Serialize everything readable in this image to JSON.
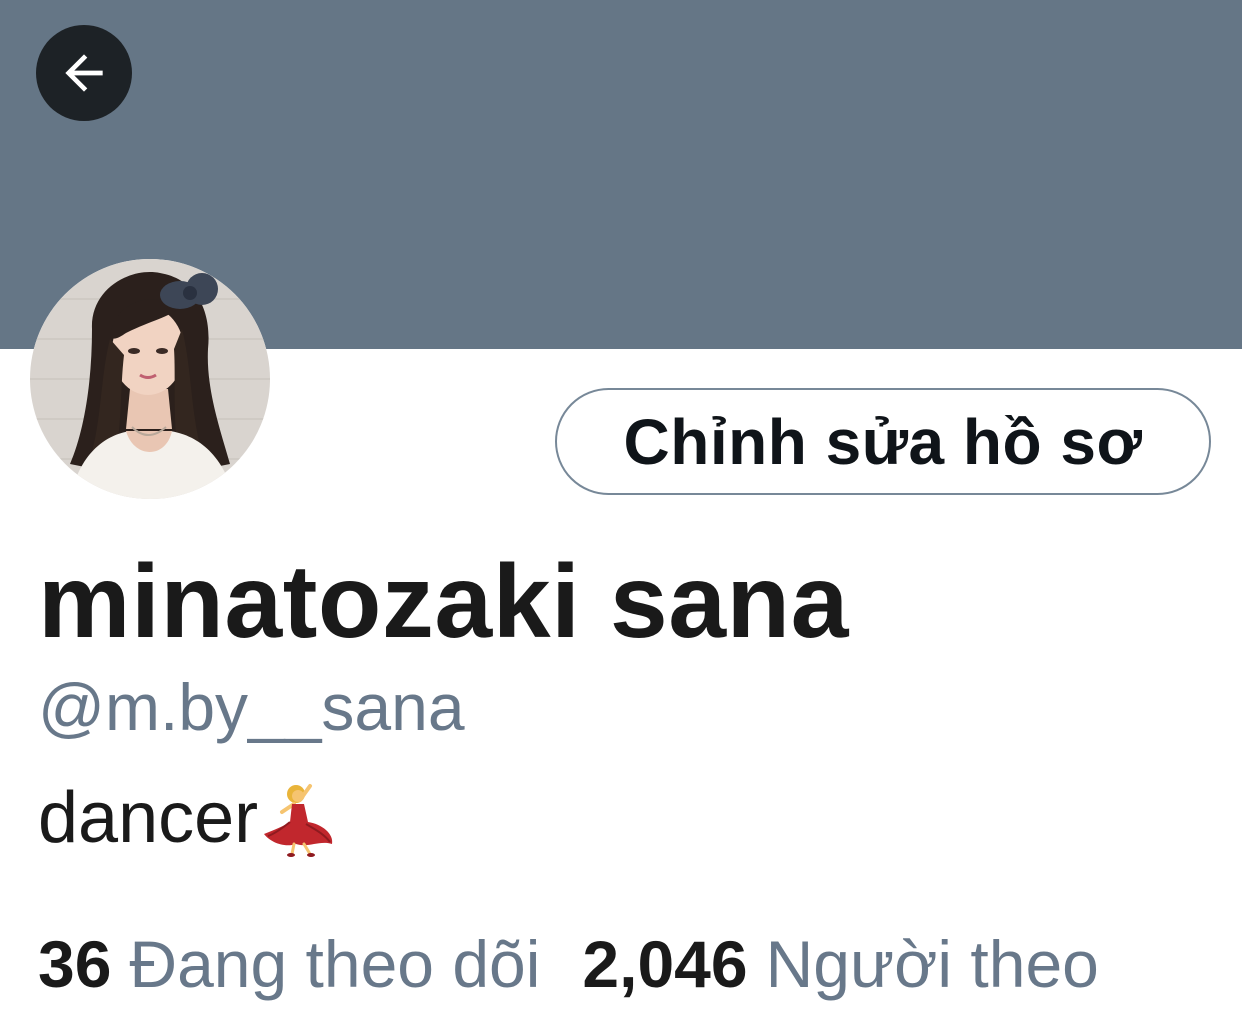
{
  "header": {
    "back_icon": "arrow-left-icon",
    "banner_color": "#657686"
  },
  "profile": {
    "avatar_icon": "profile-photo",
    "edit_button_label": "Chỉnh sửa hồ sơ",
    "display_name": "minatozaki sana",
    "handle": "@m.by__sana",
    "bio_text": "dancer",
    "bio_emoji": "dancer-emoji"
  },
  "stats": {
    "following_count": "36",
    "following_label": "Đang theo dõi",
    "followers_count": "2,046",
    "followers_label": "Người theo"
  }
}
